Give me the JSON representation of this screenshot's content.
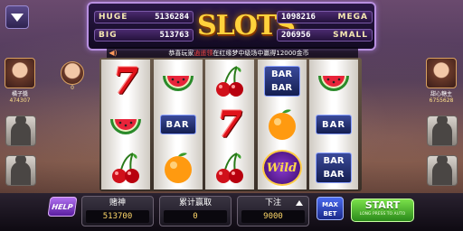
{
  "jackpot": {
    "huge_label": "HUGE",
    "huge_value": "5136284",
    "big_label": "BIG",
    "big_value": "513763",
    "mega_label": "MEGA",
    "mega_value": "1098216",
    "small_label": "SMALL",
    "small_value": "206956",
    "logo": "SLOTS"
  },
  "ticker": {
    "prefix": "恭喜玩家",
    "highlight": "逍遥领",
    "suffix": "在红缘梦中级场中赢得12000金币"
  },
  "players": {
    "left_top": {
      "name": "橘子醬",
      "coins": "474307"
    },
    "left_round": {
      "coins": "0"
    },
    "right_top": {
      "name": "甜心糖主",
      "coins": "6755628"
    }
  },
  "reels": [
    [
      "seven",
      "watermelon",
      "cherry"
    ],
    [
      "watermelon",
      "bar",
      "orange"
    ],
    [
      "cherry",
      "seven",
      "cherry"
    ],
    [
      "bar2",
      "orange",
      "wild"
    ],
    [
      "watermelon",
      "bar",
      "bar2"
    ]
  ],
  "symbol_text": {
    "bar": "BAR",
    "wild": "Wild"
  },
  "bottom": {
    "help": "HELP",
    "stat1_title": "赌神",
    "stat1_value": "513700",
    "stat2_title": "累计赢取",
    "stat2_value": "0",
    "stat3_title": "下注",
    "stat3_value": "9000",
    "maxbet_line1": "MAX",
    "maxbet_line2": "BET",
    "start": "START",
    "start_sub": "LONG PRESS TO AUTO"
  },
  "colors": {
    "accent": "#b890e0",
    "gold": "#ffd23c",
    "start_green": "#4ab82a"
  }
}
